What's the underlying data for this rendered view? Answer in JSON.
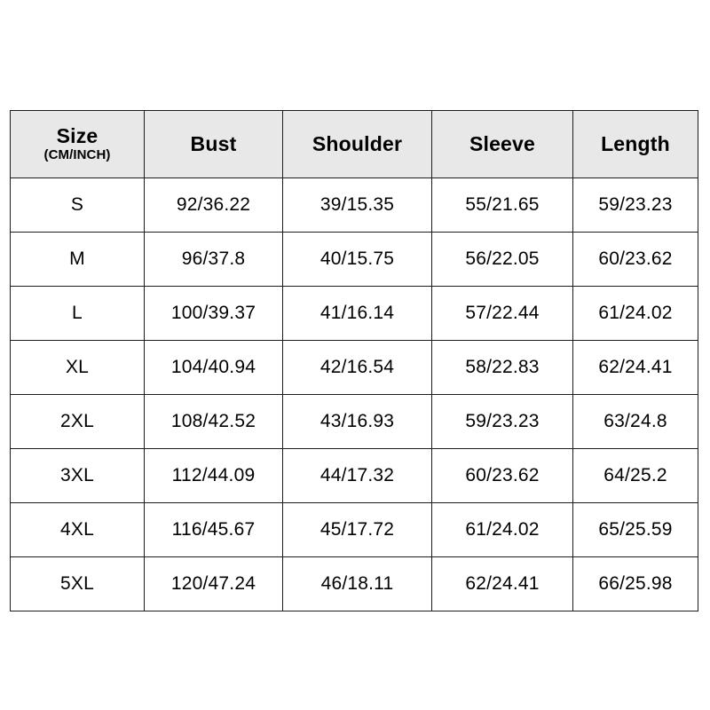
{
  "page": {
    "background_color": "#ffffff",
    "table_border_color": "#1c1c1c",
    "header_background_color": "#e8e8e8",
    "text_color": "#000000"
  },
  "table": {
    "name": "size-chart",
    "headers": [
      {
        "main": "Size",
        "sub": "(CM/INCH)"
      },
      {
        "main": "Bust",
        "sub": ""
      },
      {
        "main": "Shoulder",
        "sub": ""
      },
      {
        "main": "Sleeve",
        "sub": ""
      },
      {
        "main": "Length",
        "sub": ""
      }
    ],
    "rows": [
      {
        "size": "S",
        "bust": "92/36.22",
        "shoulder": "39/15.35",
        "sleeve": "55/21.65",
        "length": "59/23.23"
      },
      {
        "size": "M",
        "bust": "96/37.8",
        "shoulder": "40/15.75",
        "sleeve": "56/22.05",
        "length": "60/23.62"
      },
      {
        "size": "L",
        "bust": "100/39.37",
        "shoulder": "41/16.14",
        "sleeve": "57/22.44",
        "length": "61/24.02"
      },
      {
        "size": "XL",
        "bust": "104/40.94",
        "shoulder": "42/16.54",
        "sleeve": "58/22.83",
        "length": "62/24.41"
      },
      {
        "size": "2XL",
        "bust": "108/42.52",
        "shoulder": "43/16.93",
        "sleeve": "59/23.23",
        "length": "63/24.8"
      },
      {
        "size": "3XL",
        "bust": "112/44.09",
        "shoulder": "44/17.32",
        "sleeve": "60/23.62",
        "length": "64/25.2"
      },
      {
        "size": "4XL",
        "bust": "116/45.67",
        "shoulder": "45/17.72",
        "sleeve": "61/24.02",
        "length": "65/25.59"
      },
      {
        "size": "5XL",
        "bust": "120/47.24",
        "shoulder": "46/18.11",
        "sleeve": "62/24.41",
        "length": "66/25.98"
      }
    ]
  }
}
